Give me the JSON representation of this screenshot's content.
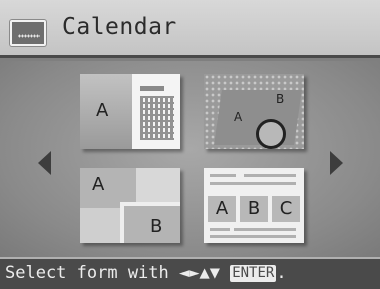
{
  "header": {
    "title": "Calendar",
    "icon": "calendar-icon"
  },
  "layouts": [
    {
      "name": "photo-left-calendar-right",
      "labels": [
        "A"
      ]
    },
    {
      "name": "decorative-two-photos",
      "labels": [
        "A",
        "B"
      ]
    },
    {
      "name": "two-photos-offset",
      "labels": [
        "A",
        "B"
      ]
    },
    {
      "name": "three-photos-row",
      "labels": [
        "A",
        "B",
        "C"
      ]
    }
  ],
  "footer": {
    "instruction": "Select form with ",
    "arrows": "◄►▲▼ ",
    "enter_label": "ENTER",
    "end": "."
  }
}
